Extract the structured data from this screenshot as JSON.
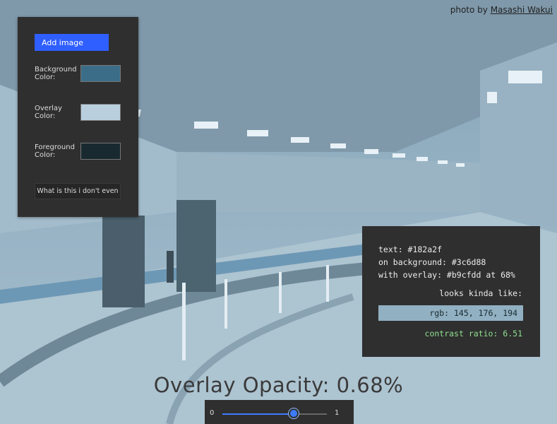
{
  "credit": {
    "prefix": "photo by",
    "author": "Masashi Wakui"
  },
  "panel": {
    "add_image_label": "Add image",
    "background_label": "Background Color:",
    "overlay_label": "Overlay Color:",
    "foreground_label": "Foreground Color:",
    "what_button_label": "What is this i don't even",
    "colors": {
      "background": "#3c6d88",
      "overlay": "#b9cfdd",
      "foreground": "#182a2f"
    }
  },
  "result": {
    "text_line": "text: #182a2f",
    "background_line": "on background: #3c6d88",
    "overlay_line": "with overlay: #b9cfdd at 68%",
    "looks_like": "looks kinda like:",
    "rgb_sample": "rgb: 145, 176, 194",
    "sample_color": "#91b0c2",
    "contrast_line": "contrast ratio: 6.51"
  },
  "opacity": {
    "title": "Overlay Opacity: 0.68%",
    "min_label": "0",
    "max_label": "1",
    "value": 0.68
  }
}
